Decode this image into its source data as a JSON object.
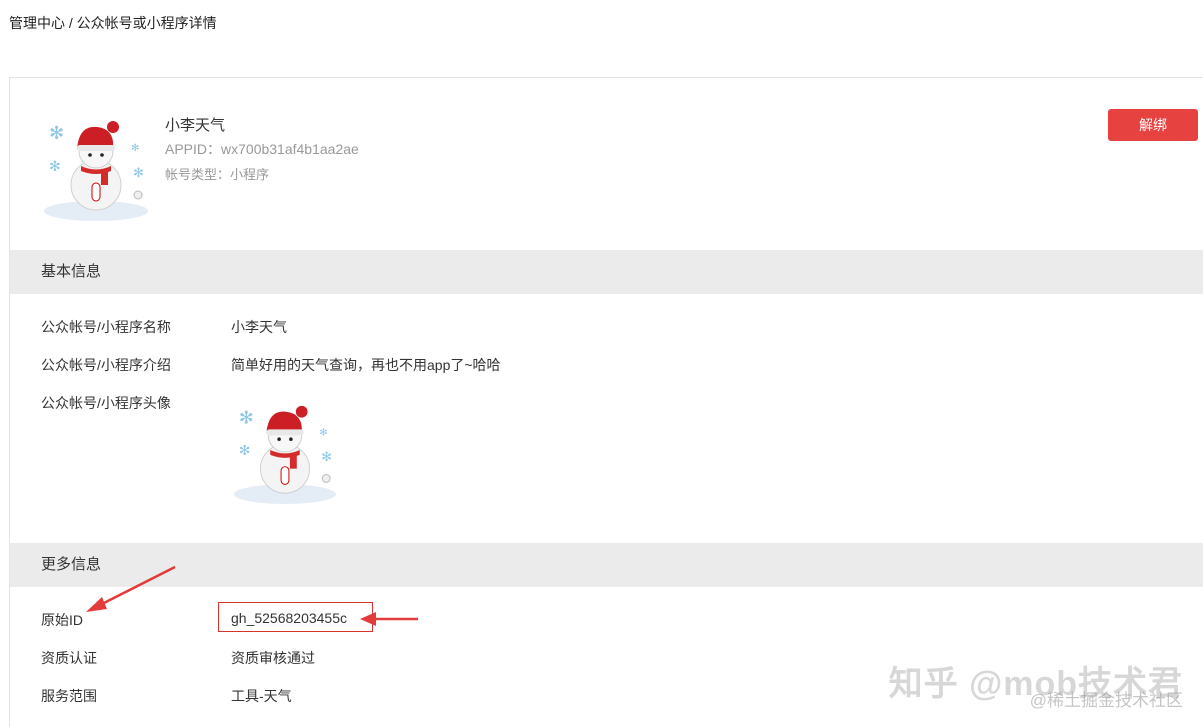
{
  "breadcrumb": "管理中心 / 公众帐号或小程序详情",
  "header": {
    "name": "小李天气",
    "appid": "APPID：wx700b31af4b1aa2ae",
    "account_type": "帐号类型：小程序",
    "unbind_label": "解绑"
  },
  "basic": {
    "title": "基本信息",
    "rows": [
      {
        "label": "公众帐号/小程序名称",
        "value": "小李天气"
      },
      {
        "label": "公众帐号/小程序介绍",
        "value": "简单好用的天气查询，再也不用app了~哈哈"
      },
      {
        "label": "公众帐号/小程序头像",
        "value": ""
      }
    ]
  },
  "more": {
    "title": "更多信息",
    "rows": [
      {
        "label": "原始ID",
        "value": "gh_52568203455c"
      },
      {
        "label": "资质认证",
        "value": "资质审核通过"
      },
      {
        "label": "服务范围",
        "value": "工具-天气"
      }
    ]
  },
  "watermark": {
    "line1": "知乎 @mob技术君",
    "line2": "@稀土掘金技术社区"
  },
  "colors": {
    "accent": "#e64340",
    "annotation": "#d9302c",
    "section_bg": "#ebebeb"
  },
  "icons": {
    "avatar": "snowman-avatar-icon",
    "annotation_arrow": "red-arrow-icon"
  }
}
